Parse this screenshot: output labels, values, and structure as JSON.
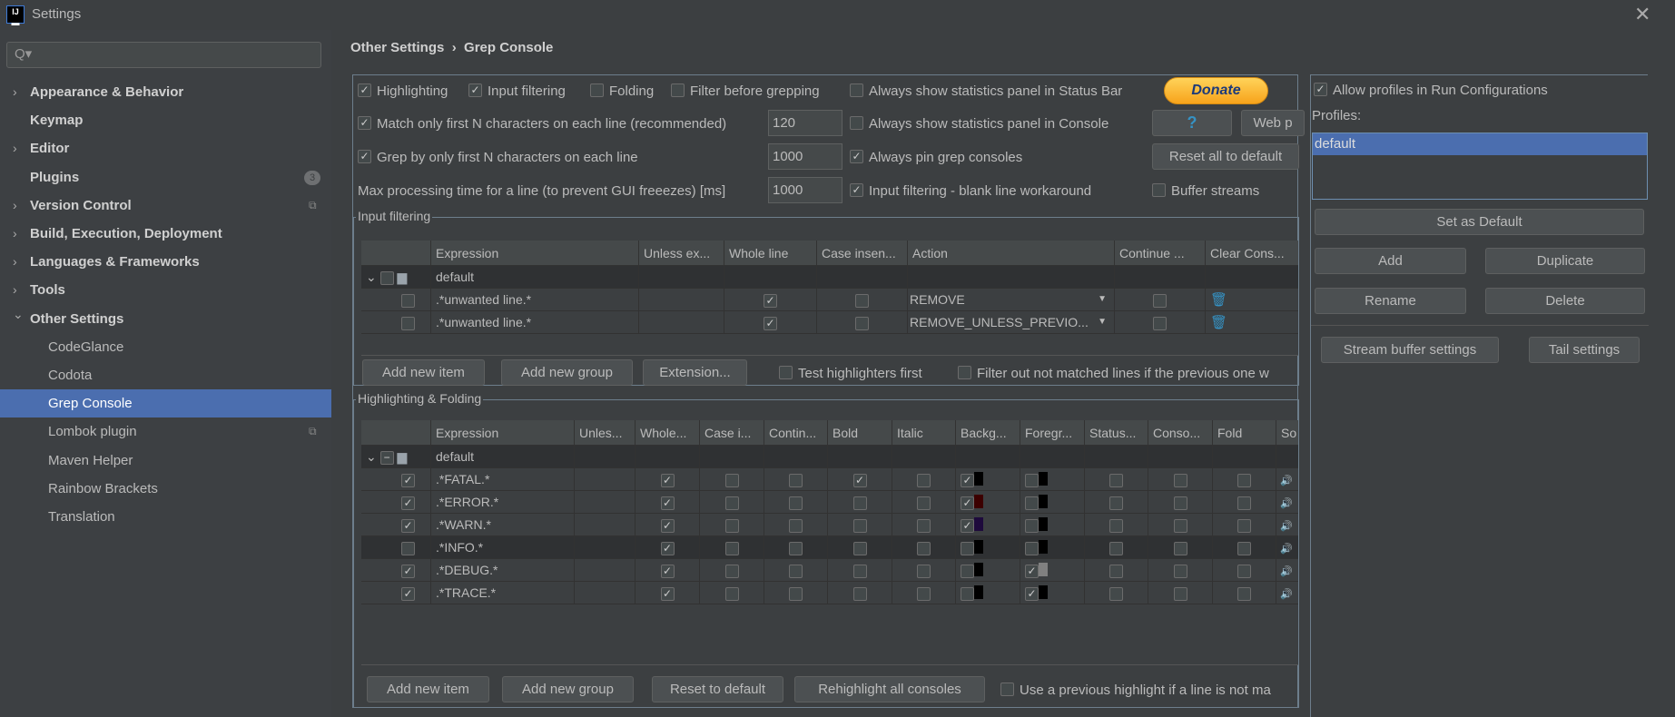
{
  "window": {
    "title": "Settings",
    "close_icon": "close-icon"
  },
  "sidebar": {
    "search_placeholder": "Q▾",
    "items": [
      {
        "label": "Appearance & Behavior",
        "expandable": true
      },
      {
        "label": "Keymap",
        "expandable": false
      },
      {
        "label": "Editor",
        "expandable": true
      },
      {
        "label": "Plugins",
        "expandable": false,
        "badge": "3"
      },
      {
        "label": "Version Control",
        "expandable": true,
        "project_icon": true
      },
      {
        "label": "Build, Execution, Deployment",
        "expandable": true
      },
      {
        "label": "Languages & Frameworks",
        "expandable": true
      },
      {
        "label": "Tools",
        "expandable": true
      },
      {
        "label": "Other Settings",
        "expandable": true,
        "expanded": true
      },
      {
        "label": "CodeGlance",
        "child": true
      },
      {
        "label": "Codota",
        "child": true
      },
      {
        "label": "Grep Console",
        "child": true,
        "selected": true
      },
      {
        "label": "Lombok plugin",
        "child": true,
        "project_icon": true
      },
      {
        "label": "Maven Helper",
        "child": true
      },
      {
        "label": "Rainbow Brackets",
        "child": true
      },
      {
        "label": "Translation",
        "child": true
      }
    ]
  },
  "breadcrumb": {
    "parent": "Other Settings",
    "separator": "›",
    "current": "Grep Console"
  },
  "options": {
    "highlighting": {
      "label": "Highlighting",
      "checked": true
    },
    "input_filtering": {
      "label": "Input filtering",
      "checked": true
    },
    "folding": {
      "label": "Folding",
      "checked": false
    },
    "filter_before": {
      "label": "Filter before grepping",
      "checked": false
    },
    "stats_status_bar": {
      "label": "Always show statistics panel in Status Bar",
      "checked": false
    },
    "match_first_n": {
      "label": "Match only first N characters on each line (recommended)",
      "checked": true,
      "value": "120"
    },
    "stats_console": {
      "label": "Always show statistics panel in Console",
      "checked": false
    },
    "grep_first_n": {
      "label": "Grep by only first N characters on each line",
      "checked": true,
      "value": "1000"
    },
    "pin_consoles": {
      "label": "Always pin grep consoles",
      "checked": true
    },
    "max_time": {
      "label": "Max processing time for a line (to prevent GUI freeezes) [ms]",
      "value": "1000"
    },
    "blank_line": {
      "label": "Input filtering - blank line workaround",
      "checked": true
    },
    "buffer_streams": {
      "label": "Buffer streams",
      "checked": false
    },
    "donate": "Donate",
    "help": "?",
    "web": "Web p",
    "reset_all": "Reset all to default"
  },
  "input_filtering": {
    "title": "Input filtering",
    "columns": [
      "",
      "Expression",
      "Unless ex...",
      "Whole line",
      "Case insen...",
      "Action",
      "Continue ...",
      "Clear Cons..."
    ],
    "group": "default",
    "rows": [
      {
        "enabled": false,
        "expression": ".*unwanted line.*",
        "whole_line": true,
        "case_insensitive": false,
        "action": "REMOVE",
        "continue": false
      },
      {
        "enabled": false,
        "expression": ".*unwanted line.*",
        "whole_line": true,
        "case_insensitive": false,
        "action": "REMOVE_UNLESS_PREVIO...",
        "continue": false
      }
    ],
    "buttons": [
      "Add new item",
      "Add new group",
      "Extension..."
    ],
    "test_highlighters": {
      "label": "Test highlighters first",
      "checked": false
    },
    "filter_out": {
      "label": "Filter out not matched lines if the previous one w",
      "checked": false
    }
  },
  "highlighting": {
    "title": "Highlighting & Folding",
    "columns": [
      "",
      "Expression",
      "Unles...",
      "Whole...",
      "Case i...",
      "Contin...",
      "Bold",
      "Italic",
      "Backg...",
      "Foregr...",
      "Status...",
      "Conso...",
      "Fold",
      "So"
    ],
    "group": "default",
    "rows": [
      {
        "enabled": true,
        "expression": ".*FATAL.*",
        "whole": true,
        "bold": true,
        "bg_on": true,
        "bg": "#000000",
        "fg_on": false,
        "fg": "#000000"
      },
      {
        "enabled": true,
        "expression": ".*ERROR.*",
        "whole": true,
        "bold": false,
        "bg_on": true,
        "bg": "#3c0000",
        "fg_on": false,
        "fg": "#000000"
      },
      {
        "enabled": true,
        "expression": ".*WARN.*",
        "whole": true,
        "bold": false,
        "bg_on": true,
        "bg": "#1e0a3c",
        "fg_on": false,
        "fg": "#000000"
      },
      {
        "enabled": false,
        "expression": ".*INFO.*",
        "whole": true,
        "bold": false,
        "bg_on": false,
        "bg": "#000000",
        "fg_on": false,
        "fg": "#000000",
        "selected": true
      },
      {
        "enabled": true,
        "expression": ".*DEBUG.*",
        "whole": true,
        "bold": false,
        "bg_on": false,
        "bg": "#000000",
        "fg_on": true,
        "fg": "#808080"
      },
      {
        "enabled": true,
        "expression": ".*TRACE.*",
        "whole": true,
        "bold": false,
        "bg_on": false,
        "bg": "#000000",
        "fg_on": true,
        "fg": "#000000"
      }
    ],
    "buttons": [
      "Add new item",
      "Add new group",
      "Reset to default",
      "Rehighlight all consoles"
    ],
    "use_previous": {
      "label": "Use a previous highlight if a line is not ma",
      "checked": false
    }
  },
  "profiles": {
    "allow": {
      "label": "Allow profiles in Run Configurations",
      "checked": true
    },
    "label": "Profiles:",
    "items": [
      "default"
    ],
    "set_default": "Set as Default",
    "add": "Add",
    "duplicate": "Duplicate",
    "rename": "Rename",
    "delete": "Delete",
    "stream_buffer": "Stream buffer settings",
    "tail": "Tail settings"
  },
  "colors": {
    "accent": "#4b6eaf",
    "background": "#3c3f41",
    "donate": "#f7a31b"
  }
}
